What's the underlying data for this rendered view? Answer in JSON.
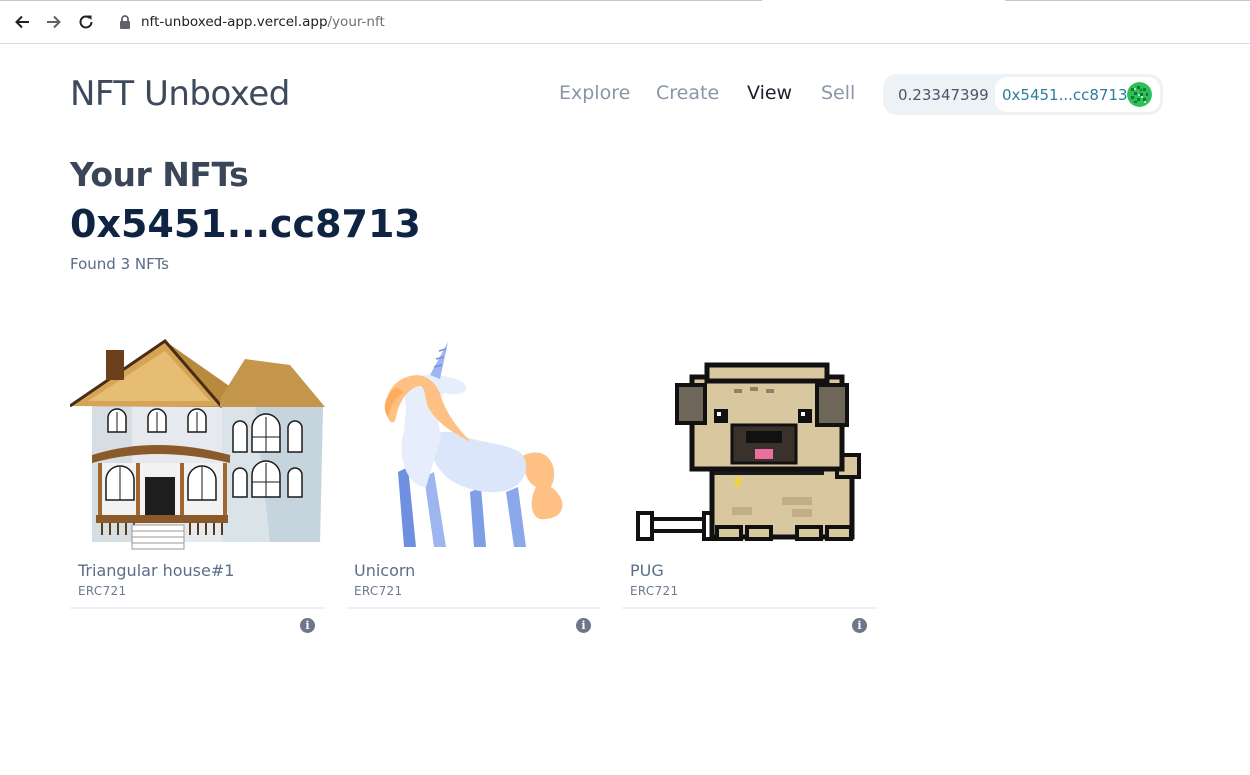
{
  "browser": {
    "url_host": "nft-unboxed-app.vercel.app",
    "url_path": "/your-nft"
  },
  "header": {
    "app_title": "NFT Unboxed",
    "nav": {
      "explore": "Explore",
      "create": "Create",
      "view": "View",
      "sell": "Sell"
    },
    "active_nav": "view",
    "account": {
      "balance": "0.23347399",
      "address": "0x5451...cc8713"
    }
  },
  "page": {
    "heading": "Your NFTs",
    "owner_address": "0x5451...cc8713",
    "found_text": "Found 3 NFTs"
  },
  "nfts": [
    {
      "name": "Triangular house#1",
      "standard": "ERC721",
      "image_icon": "triangular-house-image"
    },
    {
      "name": "Unicorn",
      "standard": "ERC721",
      "image_icon": "unicorn-image"
    },
    {
      "name": "PUG",
      "standard": "ERC721",
      "image_icon": "pixel-pug-image"
    }
  ],
  "colors": {
    "accent_link": "#2c7da0",
    "heading_dark": "#0f2343",
    "account_bg": "#edf2f7"
  }
}
